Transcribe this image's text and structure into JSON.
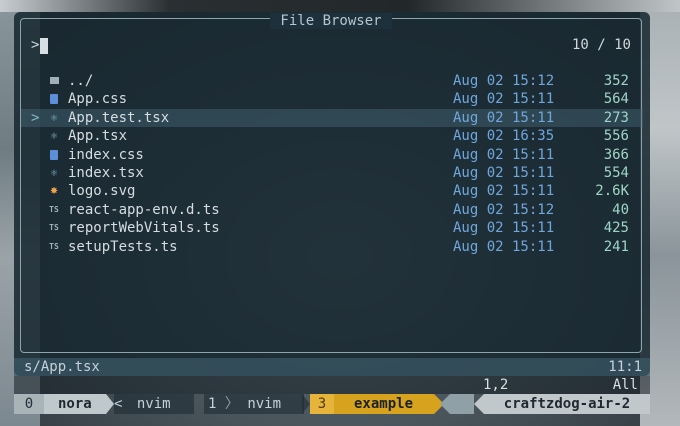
{
  "window": {
    "title": "File Browser",
    "prompt": ">",
    "match_count": "10 / 10"
  },
  "files": [
    {
      "icon": "folder-icon",
      "name": "../",
      "date": "Aug 02 15:12",
      "size": "352",
      "selected": false
    },
    {
      "icon": "css-file-icon",
      "name": "App.css",
      "date": "Aug 02 15:11",
      "size": "564",
      "selected": false
    },
    {
      "icon": "react-file-icon",
      "name": "App.test.tsx",
      "date": "Aug 02 15:11",
      "size": "273",
      "selected": true
    },
    {
      "icon": "react-file-icon",
      "name": "App.tsx",
      "date": "Aug 02 16:35",
      "size": "556",
      "selected": false
    },
    {
      "icon": "css-file-icon",
      "name": "index.css",
      "date": "Aug 02 15:11",
      "size": "366",
      "selected": false
    },
    {
      "icon": "react-file-icon",
      "name": "index.tsx",
      "date": "Aug 02 15:11",
      "size": "554",
      "selected": false
    },
    {
      "icon": "svg-file-icon",
      "name": "logo.svg",
      "date": "Aug 02 15:11",
      "size": "2.6K",
      "selected": false
    },
    {
      "icon": "ts-file-icon",
      "name": "react-app-env.d.ts",
      "date": "Aug 02 15:12",
      "size": "40",
      "selected": false
    },
    {
      "icon": "ts-file-icon",
      "name": "reportWebVitals.ts",
      "date": "Aug 02 15:11",
      "size": "425",
      "selected": false
    },
    {
      "icon": "ts-file-icon",
      "name": "setupTests.ts",
      "date": "Aug 02 15:11",
      "size": "241",
      "selected": false
    }
  ],
  "selection_marker": ">",
  "statusline": {
    "path": "s/App.tsx",
    "position": "11:1"
  },
  "ruler": {
    "position": "1,2",
    "scroll": "All"
  },
  "tmux": {
    "session_index": "0",
    "session_name": "nora",
    "windows": [
      {
        "index": "<",
        "name": "nvim"
      },
      {
        "index": "1",
        "name": "nvim"
      }
    ],
    "active_window": {
      "index": "3",
      "name": "example"
    },
    "hostname": "craftzdog-air-2"
  },
  "colors": {
    "date": "#6fa7dc",
    "size": "#9ed6c6",
    "active_window": "#d7a31e"
  }
}
